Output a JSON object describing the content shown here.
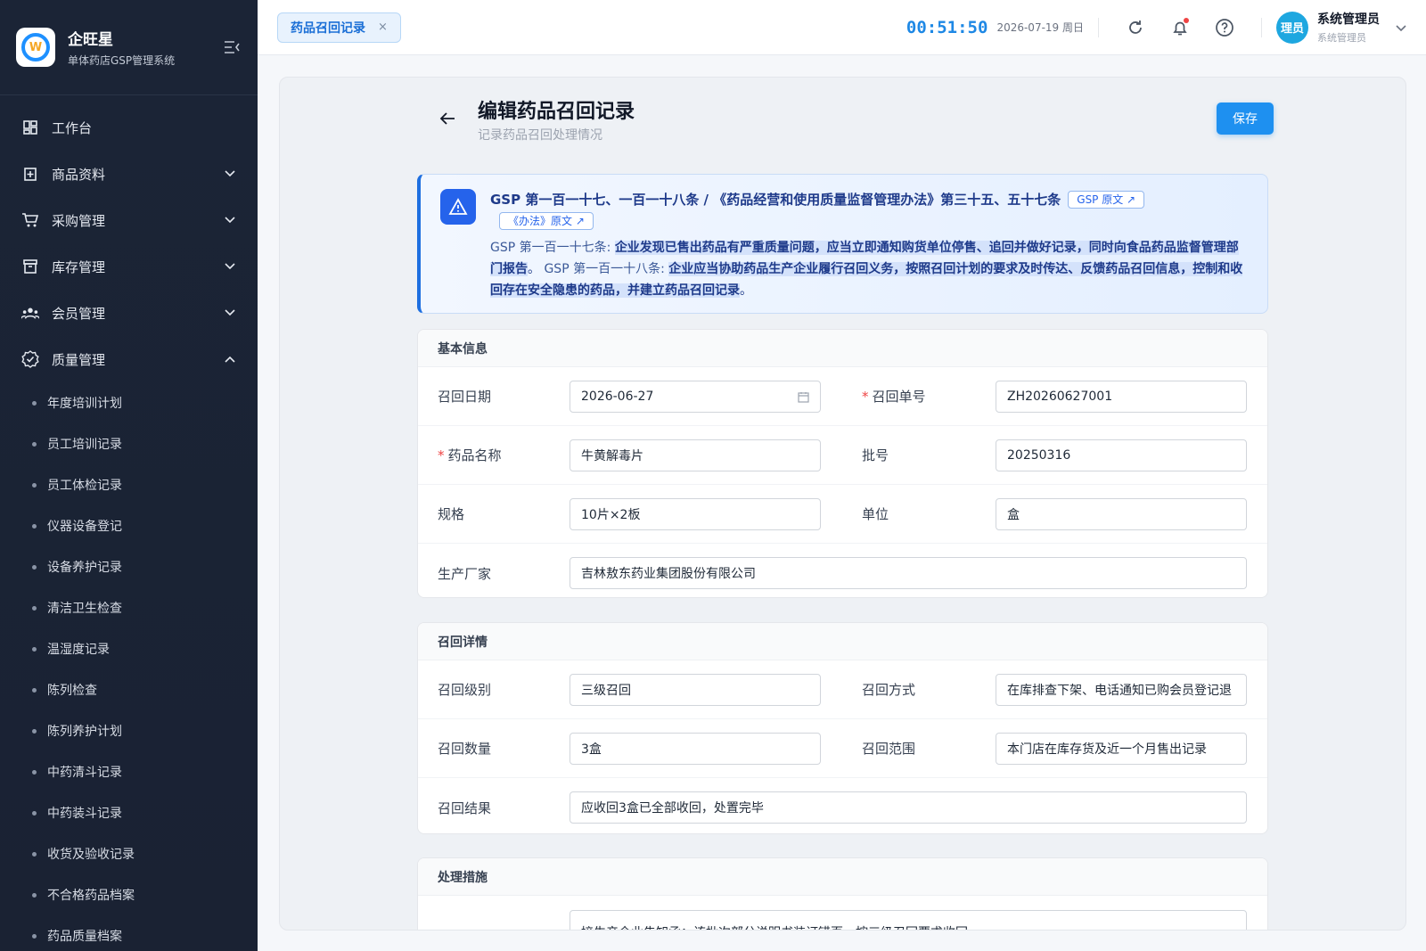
{
  "brand": {
    "name": "企旺星",
    "subtitle": "单体药店GSP管理系统",
    "logo_letter": "W"
  },
  "nav": [
    {
      "label": "工作台",
      "icon": "dashboard-icon"
    },
    {
      "label": "商品资料",
      "icon": "product-icon"
    },
    {
      "label": "采购管理",
      "icon": "cart-icon"
    },
    {
      "label": "库存管理",
      "icon": "inventory-icon"
    },
    {
      "label": "会员管理",
      "icon": "members-icon"
    },
    {
      "label": "质量管理",
      "icon": "quality-icon"
    }
  ],
  "quality_sub": [
    "年度培训计划",
    "员工培训记录",
    "员工体检记录",
    "仪器设备登记",
    "设备养护记录",
    "清洁卫生检查",
    "温湿度记录",
    "陈列检查",
    "陈列养护计划",
    "中药清斗记录",
    "中药装斗记录",
    "收货及验收记录",
    "不合格药品档案",
    "药品质量档案"
  ],
  "tab": {
    "label": "药品召回记录",
    "close": "×"
  },
  "header": {
    "clock": "00:51:50",
    "date": "2026-07-19 周日",
    "avatar_text": "理员",
    "user_name": "系统管理员",
    "user_role": "系统管理员"
  },
  "page": {
    "title": "编辑药品召回记录",
    "subtitle": "记录药品召回处理情况",
    "save_label": "保存"
  },
  "notice": {
    "title": "GSP 第一百一十七、一百一十八条 / 《药品经营和使用质量监督管理办法》第三十五、五十七条",
    "chip1": "GSP 原文 ↗",
    "chip2": "《办法》原文 ↗",
    "art1_label": "GSP 第一百一十七条:",
    "art1_text": "企业发现已售出药品有严重质量问题，应当立即通知购货单位停售、追回并做好记录，同时向食品药品监督管理部门报告",
    "art2_label": "GSP 第一百一十八条:",
    "art2_text": "企业应当协助药品生产企业履行召回义务，按照召回计划的要求及时传达、反馈药品召回信息，控制和收回存在安全隐患的药品，并建立药品召回记录",
    "period": "。"
  },
  "basic": {
    "header": "基本信息",
    "recall_date_label": "召回日期",
    "recall_date": "2026-06-27",
    "recall_no_label": "召回单号",
    "recall_no": "ZH20260627001",
    "drug_name_label": "药品名称",
    "drug_name": "牛黄解毒片",
    "batch_label": "批号",
    "batch": "20250316",
    "spec_label": "规格",
    "spec": "10片×2板",
    "unit_label": "单位",
    "unit": "盒",
    "maker_label": "生产厂家",
    "maker": "吉林敖东药业集团股份有限公司",
    "required_mark": "*"
  },
  "detail": {
    "header": "召回详情",
    "level_label": "召回级别",
    "level": "三级召回",
    "method_label": "召回方式",
    "method": "在库排查下架、电话通知已购会员登记退",
    "qty_label": "召回数量",
    "qty": "3盒",
    "scope_label": "召回范围",
    "scope": "本门店在库存货及近一个月售出记录",
    "result_label": "召回结果",
    "result": "应收回3盒已全部收回，处置完毕"
  },
  "measures": {
    "header": "处理措施",
    "text": "接生产企业告知函：该批次部分说明书装订错页，按三级召回要求收回"
  },
  "colors": {
    "primary": "#1e90f0",
    "sidebar_bg": "#1b2436",
    "notice_accent": "#1e6fe0"
  }
}
